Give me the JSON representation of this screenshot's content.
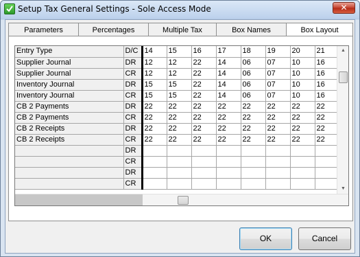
{
  "window": {
    "title": "Setup Tax General Settings - Sole Access Mode",
    "close_label": "✕"
  },
  "tabs": [
    {
      "label": "Parameters",
      "active": false
    },
    {
      "label": "Percentages",
      "active": false
    },
    {
      "label": "Multiple Tax",
      "active": false
    },
    {
      "label": "Box Names",
      "active": false
    },
    {
      "label": "Box Layout",
      "active": true
    }
  ],
  "grid": {
    "header": {
      "label": "Entry Type",
      "dc": "D/C",
      "cols": [
        "14",
        "15",
        "16",
        "17",
        "18",
        "19",
        "20",
        "21"
      ]
    },
    "rows": [
      {
        "label": "Supplier Journal",
        "dc": "DR",
        "vals": [
          "12",
          "12",
          "22",
          "14",
          "06",
          "07",
          "10",
          "16"
        ]
      },
      {
        "label": "Supplier Journal",
        "dc": "CR",
        "vals": [
          "12",
          "12",
          "22",
          "14",
          "06",
          "07",
          "10",
          "16"
        ]
      },
      {
        "label": "Inventory Journal",
        "dc": "DR",
        "vals": [
          "15",
          "15",
          "22",
          "14",
          "06",
          "07",
          "10",
          "16"
        ]
      },
      {
        "label": "Inventory Journal",
        "dc": "CR",
        "vals": [
          "15",
          "15",
          "22",
          "14",
          "06",
          "07",
          "10",
          "16"
        ]
      },
      {
        "label": "CB 2 Payments",
        "dc": "DR",
        "vals": [
          "22",
          "22",
          "22",
          "22",
          "22",
          "22",
          "22",
          "22"
        ]
      },
      {
        "label": "CB 2 Payments",
        "dc": "CR",
        "vals": [
          "22",
          "22",
          "22",
          "22",
          "22",
          "22",
          "22",
          "22"
        ]
      },
      {
        "label": "CB 2 Receipts",
        "dc": "DR",
        "vals": [
          "22",
          "22",
          "22",
          "22",
          "22",
          "22",
          "22",
          "22"
        ]
      },
      {
        "label": "CB 2 Receipts",
        "dc": "CR",
        "vals": [
          "22",
          "22",
          "22",
          "22",
          "22",
          "22",
          "22",
          "22"
        ]
      },
      {
        "label": "",
        "dc": "DR",
        "vals": [
          "",
          "",
          "",
          "",
          "",
          "",
          "",
          ""
        ]
      },
      {
        "label": "",
        "dc": "CR",
        "vals": [
          "",
          "",
          "",
          "",
          "",
          "",
          "",
          ""
        ]
      },
      {
        "label": "",
        "dc": "DR",
        "vals": [
          "",
          "",
          "",
          "",
          "",
          "",
          "",
          ""
        ]
      },
      {
        "label": "",
        "dc": "CR",
        "vals": [
          "",
          "",
          "",
          "",
          "",
          "",
          "",
          ""
        ]
      }
    ]
  },
  "buttons": {
    "ok": "OK",
    "cancel": "Cancel"
  }
}
